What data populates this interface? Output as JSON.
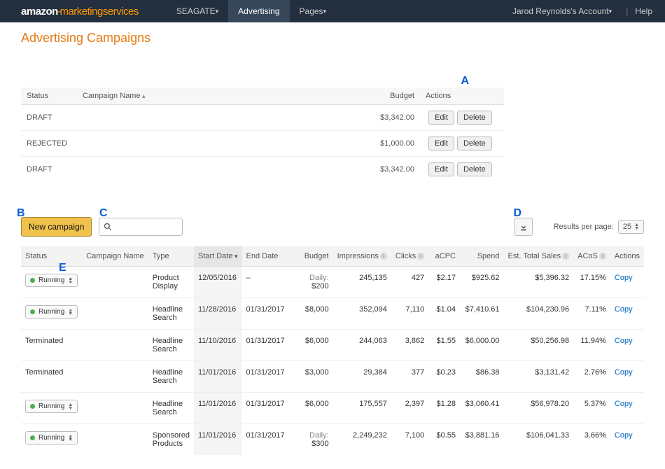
{
  "nav": {
    "logo_amazon": "amazon",
    "logo_ms": "marketingservices",
    "items": [
      {
        "label": "SEAGATE",
        "active": false,
        "caret": true
      },
      {
        "label": "Advertising",
        "active": true,
        "caret": false
      },
      {
        "label": "Pages",
        "active": false,
        "caret": true
      }
    ],
    "account_label": "Jarod Reynolds's Account",
    "help_label": "Help"
  },
  "page_title": "Advertising Campaigns",
  "annotations": {
    "A": "A",
    "B": "B",
    "C": "C",
    "D": "D",
    "E": "E"
  },
  "drafts_table": {
    "columns": {
      "status": "Status",
      "campaign_name": "Campaign Name",
      "budget": "Budget",
      "actions": "Actions"
    },
    "rows": [
      {
        "status": "DRAFT",
        "name": "",
        "budget": "$3,342.00"
      },
      {
        "status": "REJECTED",
        "name": "",
        "budget": "$1,000.00"
      },
      {
        "status": "DRAFT",
        "name": "",
        "budget": "$3,342.00"
      }
    ],
    "edit_label": "Edit",
    "delete_label": "Delete"
  },
  "controls": {
    "new_campaign_label": "New campaign",
    "search_placeholder": "",
    "results_per_page_label": "Results per page:",
    "results_per_page_value": "25"
  },
  "campaigns_table": {
    "columns": {
      "status": "Status",
      "campaign_name": "Campaign Name",
      "type": "Type",
      "start_date": "Start Date",
      "end_date": "End Date",
      "budget": "Budget",
      "impressions": "Impressions",
      "clicks": "Clicks",
      "acpc": "aCPC",
      "spend": "Spend",
      "est_total_sales": "Est. Total Sales",
      "acos": "ACoS",
      "actions": "Actions"
    },
    "copy_label": "Copy",
    "daily_prefix": "Daily: ",
    "rows": [
      {
        "status": "Running",
        "status_mode": "pill",
        "type": "Product Display",
        "start": "12/05/2016",
        "end": "–",
        "budget_prefix": "Daily: ",
        "budget": "$200",
        "impr": "245,135",
        "clicks": "427",
        "acpc": "$2.17",
        "spend": "$925.62",
        "sales": "$5,396.32",
        "acos": "17.15%"
      },
      {
        "status": "Running",
        "status_mode": "pill",
        "type": "Headline Search",
        "start": "11/28/2016",
        "end": "01/31/2017",
        "budget_prefix": "",
        "budget": "$8,000",
        "impr": "352,094",
        "clicks": "7,110",
        "acpc": "$1.04",
        "spend": "$7,410.61",
        "sales": "$104,230.96",
        "acos": "7.11%"
      },
      {
        "status": "Terminated",
        "status_mode": "text",
        "type": "Headline Search",
        "start": "11/10/2016",
        "end": "01/31/2017",
        "budget_prefix": "",
        "budget": "$6,000",
        "impr": "244,063",
        "clicks": "3,862",
        "acpc": "$1.55",
        "spend": "$6,000.00",
        "sales": "$50,256.98",
        "acos": "11.94%"
      },
      {
        "status": "Terminated",
        "status_mode": "text",
        "type": "Headline Search",
        "start": "11/01/2016",
        "end": "01/31/2017",
        "budget_prefix": "",
        "budget": "$3,000",
        "impr": "29,384",
        "clicks": "377",
        "acpc": "$0.23",
        "spend": "$86.38",
        "sales": "$3,131.42",
        "acos": "2.76%"
      },
      {
        "status": "Running",
        "status_mode": "pill",
        "type": "Headline Search",
        "start": "11/01/2016",
        "end": "01/31/2017",
        "budget_prefix": "",
        "budget": "$6,000",
        "impr": "175,557",
        "clicks": "2,397",
        "acpc": "$1.28",
        "spend": "$3,060.41",
        "sales": "$56,978.20",
        "acos": "5.37%"
      },
      {
        "status": "Running",
        "status_mode": "pill",
        "type": "Sponsored Products",
        "start": "11/01/2016",
        "end": "01/31/2017",
        "budget_prefix": "Daily: ",
        "budget": "$300",
        "impr": "2,249,232",
        "clicks": "7,100",
        "acpc": "$0.55",
        "spend": "$3,881.16",
        "sales": "$106,041.33",
        "acos": "3.66%"
      }
    ]
  }
}
